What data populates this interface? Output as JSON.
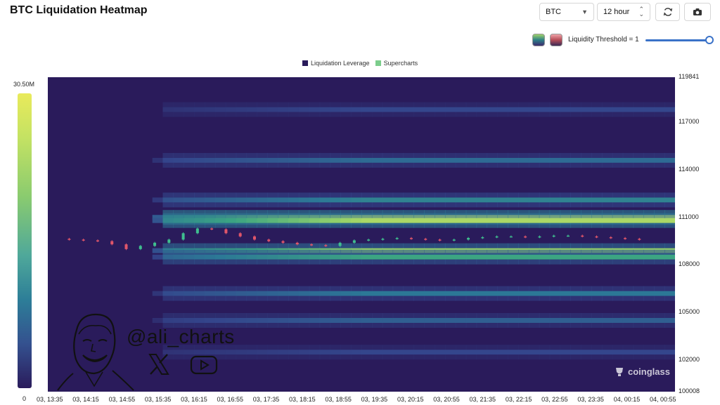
{
  "title": "BTC Liquidation Heatmap",
  "controls": {
    "symbol": "BTC",
    "interval": "12 hour",
    "refresh_icon": "refresh-icon",
    "camera_icon": "camera-icon"
  },
  "threshold_label": "Liquidity Threshold = 1",
  "threshold_value": 1,
  "legend": [
    {
      "label": "Liquidation Leverage",
      "color": "#2a1b5b"
    },
    {
      "label": "Supercharts",
      "color": "#7ccd8c"
    }
  ],
  "colorbar": {
    "max_label": "30.50M",
    "min_label": "0"
  },
  "watermark": {
    "handle": "@ali_charts",
    "brand": "coinglass"
  },
  "chart_data": {
    "type": "heatmap",
    "title": "BTC Liquidation Heatmap",
    "y_ticks": [
      "119841",
      "117000",
      "114000",
      "111000",
      "108000",
      "105000",
      "102000",
      "100008"
    ],
    "ylim": [
      100008,
      119841
    ],
    "x_ticks": [
      "03, 13:35",
      "03, 14:15",
      "03, 14:55",
      "03, 15:35",
      "03, 16:15",
      "03, 16:55",
      "03, 17:35",
      "03, 18:15",
      "03, 18:55",
      "03, 19:35",
      "03, 20:15",
      "03, 20:55",
      "03, 21:35",
      "03, 22:15",
      "03, 22:55",
      "03, 23:35",
      "04, 00:15",
      "04, 00:55"
    ],
    "intensity_range": [
      0,
      30500000
    ],
    "liquidity_bands": [
      {
        "price": 111000,
        "intensity": 0.95
      },
      {
        "price": 110800,
        "intensity": 0.85
      },
      {
        "price": 108900,
        "intensity": 0.8
      },
      {
        "price": 108500,
        "intensity": 0.6
      },
      {
        "price": 112100,
        "intensity": 0.45
      },
      {
        "price": 106200,
        "intensity": 0.4
      },
      {
        "price": 114600,
        "intensity": 0.35
      },
      {
        "price": 104500,
        "intensity": 0.3
      },
      {
        "price": 117800,
        "intensity": 0.2
      },
      {
        "price": 102500,
        "intensity": 0.2
      }
    ],
    "price_series": [
      109650,
      109600,
      109550,
      109500,
      109300,
      109000,
      109200,
      109400,
      109600,
      110000,
      110300,
      110250,
      110000,
      109800,
      109600,
      109500,
      109400,
      109300,
      109250,
      109200,
      109400,
      109550,
      109600,
      109650,
      109700,
      109650,
      109600,
      109550,
      109600,
      109700,
      109750,
      109800,
      109800,
      109750,
      109800,
      109850,
      109850,
      109800,
      109750,
      109700,
      109650,
      109600
    ]
  }
}
